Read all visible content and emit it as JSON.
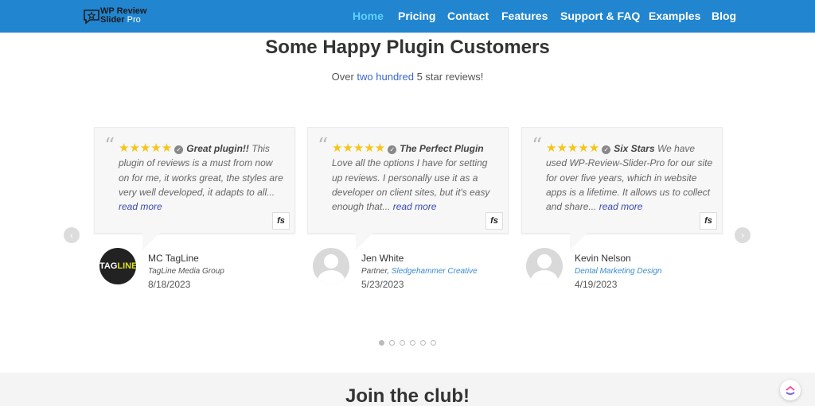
{
  "header": {
    "logo": {
      "line1": "WP Review",
      "line2": "Slider",
      "pro": "Pro",
      "icon": "star-chat-icon"
    },
    "nav": [
      {
        "label": "Home",
        "active": true
      },
      {
        "label": "Pricing",
        "active": false
      },
      {
        "label": "Contact",
        "active": false
      },
      {
        "label": "Features",
        "active": false
      },
      {
        "label": "Support & FAQ",
        "active": false
      },
      {
        "label": "Examples",
        "active": false
      },
      {
        "label": "Blog",
        "active": false
      }
    ]
  },
  "main": {
    "title": "Some Happy Plugin Customers",
    "subtitle": {
      "before": "Over ",
      "link": "two hundred",
      "after": " 5 star reviews!"
    },
    "reviews": [
      {
        "stars": "★★★★★",
        "title": "Great plugin!!",
        "text": " This plugin of reviews is a must from now on for me, it works great, the styles are very well developed, it adapts to all... ",
        "read_more": "read more",
        "source": "fs",
        "name": "MC TagLine",
        "company": "TagLine Media Group",
        "company_prefix": "",
        "date": "8/18/2023",
        "avatar": "tagline-logo"
      },
      {
        "stars": "★★★★★",
        "title": "The Perfect Plugin",
        "text": " Love all the options I have for setting up reviews. I personally use it as a developer on client sites, but it's easy enough that... ",
        "read_more": "read more",
        "source": "fs",
        "name": "Jen White",
        "company_prefix": "Partner, ",
        "company": "Sledgehammer Creative",
        "date": "5/23/2023",
        "avatar": "generic-user"
      },
      {
        "stars": "★★★★★",
        "title": "Six Stars",
        "text": " We have used WP-Review-Slider-Pro for our site for over five years, which in website apps is a lifetime. It allows us to collect and share... ",
        "read_more": "read more",
        "source": "fs",
        "name": "Kevin Nelson",
        "company_prefix": "",
        "company": "Dental Marketing Design",
        "date": "4/19/2023",
        "avatar": "generic-user"
      }
    ],
    "avatar_tagline": {
      "part1": "TAG",
      "part2": "LINE"
    },
    "arrows": {
      "prev": "‹",
      "next": "›"
    },
    "pagination": {
      "count": 6,
      "active": 0
    },
    "colors": {
      "header": "#2185d0",
      "nav_active": "#5fd0ff",
      "stars": "#f5c518",
      "link": "#3a67c9"
    }
  },
  "footer_section": {
    "title": "Join the club!"
  }
}
